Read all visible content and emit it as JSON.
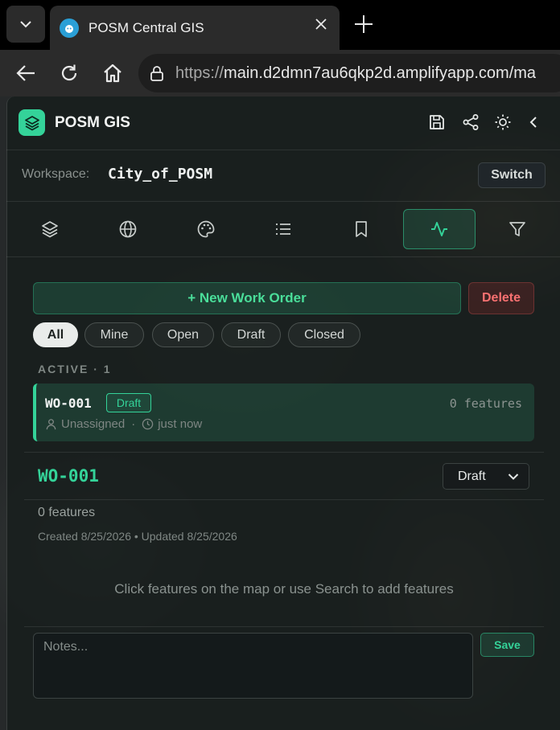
{
  "browser": {
    "tab_title": "POSM Central GIS",
    "url_scheme": "https://",
    "url_rest": "main.d2dmn7au6qkp2d.amplifyapp.com/ma"
  },
  "header": {
    "app_title": "POSM GIS",
    "icons": [
      "save-icon",
      "share-icon",
      "sun-icon",
      "chevron-left-icon"
    ]
  },
  "workspace": {
    "label": "Workspace:",
    "name": "City_of_POSM",
    "switch_label": "Switch"
  },
  "toolbar": {
    "icons": [
      "layers-icon",
      "globe-icon",
      "palette-icon",
      "list-icon",
      "bookmark-icon",
      "activity-icon",
      "filter-icon"
    ],
    "active": "activity-icon"
  },
  "actions": {
    "new_work_order": "+ New Work Order",
    "delete": "Delete"
  },
  "filters": [
    {
      "label": "All",
      "active": true
    },
    {
      "label": "Mine",
      "active": false
    },
    {
      "label": "Open",
      "active": false
    },
    {
      "label": "Draft",
      "active": false
    },
    {
      "label": "Closed",
      "active": false
    }
  ],
  "section": {
    "label": "ACTIVE",
    "sep": "·",
    "count": "1"
  },
  "work_orders": [
    {
      "id": "WO-001",
      "status": "Draft",
      "features": "0 features",
      "assignee": "Unassigned",
      "dot": "·",
      "time": "just now"
    }
  ],
  "detail": {
    "title": "WO-001",
    "status": "Draft",
    "feature_count": "0 features",
    "dates": "Created 8/25/2026 • Updated 8/25/2026",
    "empty_message": "Click features on the map or use Search to add features",
    "notes_placeholder": "Notes...",
    "save_label": "Save"
  },
  "colors": {
    "accent": "#34d399",
    "danger": "#f87171"
  }
}
